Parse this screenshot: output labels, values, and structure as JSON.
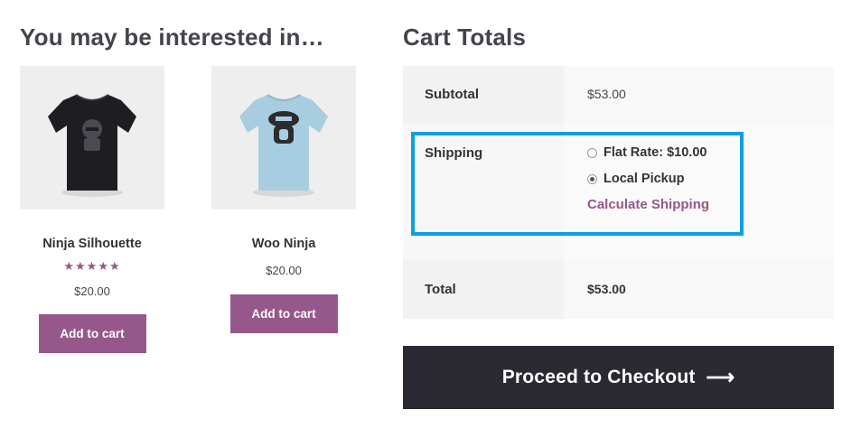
{
  "related": {
    "title": "You may be interested in…",
    "products": [
      {
        "name": "Ninja Silhouette",
        "rating": "★★★★★",
        "price": "$20.00",
        "button": "Add to cart"
      },
      {
        "name": "Woo Ninja",
        "price": "$20.00",
        "button": "Add to cart"
      }
    ]
  },
  "cart_totals": {
    "title": "Cart Totals",
    "subtotal_label": "Subtotal",
    "subtotal_value": "$53.00",
    "shipping_label": "Shipping",
    "shipping_options": [
      {
        "label": "Flat Rate: $10.00",
        "selected": false
      },
      {
        "label": "Local Pickup",
        "selected": true
      }
    ],
    "calculate_shipping": "Calculate Shipping",
    "total_label": "Total",
    "total_value": "$53.00"
  },
  "checkout_button": {
    "label": "Proceed to Checkout",
    "icon": "arrow-right-icon",
    "arrow": "⟶"
  },
  "colors": {
    "brand_purple": "#96588a",
    "highlight_blue": "#0b9fe3",
    "checkout_dark": "#2b2a33",
    "shirt_black": "#1e1e22",
    "shirt_light_blue": "#a9cde0"
  }
}
